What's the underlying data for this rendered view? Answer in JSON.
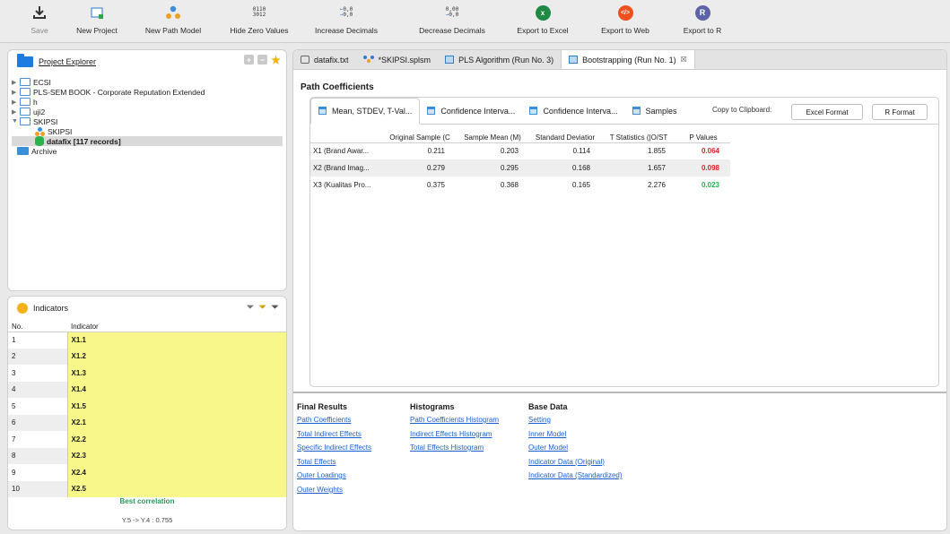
{
  "toolbar": {
    "save": "Save",
    "new_project": "New Project",
    "new_path_model": "New Path Model",
    "hide_zero": "Hide Zero Values",
    "hide_zero_digits_top": "0110",
    "hide_zero_digits_bottom": "3012",
    "increase_decimals": "Increase Decimals",
    "increase_digits_top": "0,0",
    "increase_digits_bottom": "0,0",
    "decrease_decimals": "Decrease Decimals",
    "decrease_digits_top": "0,00",
    "decrease_digits_bottom": "0,0",
    "export_excel": "Export to Excel",
    "export_web": "Export to Web",
    "export_r": "Export to R",
    "r_glyph": "R"
  },
  "project_explorer": {
    "title": "Project Explorer",
    "items": [
      {
        "label": "ECSI"
      },
      {
        "label": "PLS-SEM BOOK - Corporate Reputation Extended"
      },
      {
        "label": "h"
      },
      {
        "label": "uji2"
      },
      {
        "label": "SKIPSI"
      },
      {
        "label": "SKIPSI"
      },
      {
        "label": "datafix [117 records]"
      },
      {
        "label": "Archive"
      }
    ]
  },
  "indicators": {
    "title": "Indicators",
    "col_no": "No.",
    "col_indicator": "Indicator",
    "rows": [
      {
        "no": "1",
        "name": "X1.1"
      },
      {
        "no": "2",
        "name": "X1.2"
      },
      {
        "no": "3",
        "name": "X1.3"
      },
      {
        "no": "4",
        "name": "X1.4"
      },
      {
        "no": "5",
        "name": "X1.5"
      },
      {
        "no": "6",
        "name": "X2.1"
      },
      {
        "no": "7",
        "name": "X2.2"
      },
      {
        "no": "8",
        "name": "X2.3"
      },
      {
        "no": "9",
        "name": "X2.4"
      },
      {
        "no": "10",
        "name": "X2.5"
      }
    ],
    "best_label": "Best correlation",
    "best_value": "Y.5 -> Y.4 : 0.755"
  },
  "editor": {
    "tabs": [
      {
        "label": "datafix.txt"
      },
      {
        "label": "*SKIPSI.splsm"
      },
      {
        "label": "PLS Algorithm (Run No. 3)"
      },
      {
        "label": "Bootstrapping (Run No. 1)"
      }
    ],
    "close_glyph": "☒",
    "section_title": "Path Coefficients",
    "inner_tabs": [
      {
        "label": "Mean, STDEV, T-Val..."
      },
      {
        "label": "Confidence Interva..."
      },
      {
        "label": "Confidence Interva..."
      },
      {
        "label": "Samples"
      }
    ],
    "copy_label": "Copy to Clipboard:",
    "excel_format": "Excel Format",
    "r_format": "R Format",
    "columns": [
      "Original Sample (C",
      "Sample Mean (M)",
      "Standard Deviatior",
      "T Statistics (|O/ST",
      "P Values"
    ],
    "rows": [
      {
        "name": "X1 (Brand Awar...",
        "o": "0.211",
        "m": "0.203",
        "sd": "0.114",
        "t": "1.855",
        "p": "0.064"
      },
      {
        "name": "X2 (Brand Imag...",
        "o": "0.279",
        "m": "0.295",
        "sd": "0.168",
        "t": "1.657",
        "p": "0.098"
      },
      {
        "name": "X3 (Kualitas Pro...",
        "o": "0.375",
        "m": "0.368",
        "sd": "0.165",
        "t": "2.276",
        "p": "0.023"
      }
    ]
  },
  "results": {
    "final_title": "Final Results",
    "final_links": [
      "Path Coefficients",
      "Total Indirect Effects",
      "Specific Indirect Effects",
      "Total Effects",
      "Outer Loadings",
      "Outer Weights"
    ],
    "hist_title": "Histograms",
    "hist_links": [
      "Path Coefficients Histogram",
      "Indirect Effects Histogram",
      "Total Effects Histogram"
    ],
    "base_title": "Base Data",
    "base_links": [
      "Setting",
      "Inner Model",
      "Outer Model",
      "Indicator Data (Original)",
      "Indicator Data (Standardized)"
    ]
  },
  "colors": {
    "p_significant": "#20b050",
    "p_not_significant": "#e0202a",
    "indicator_highlight": "#f8f88a",
    "excel_green": "#1f8a43",
    "web_orange": "#f0501e",
    "r_purple": "#5d63a8"
  }
}
